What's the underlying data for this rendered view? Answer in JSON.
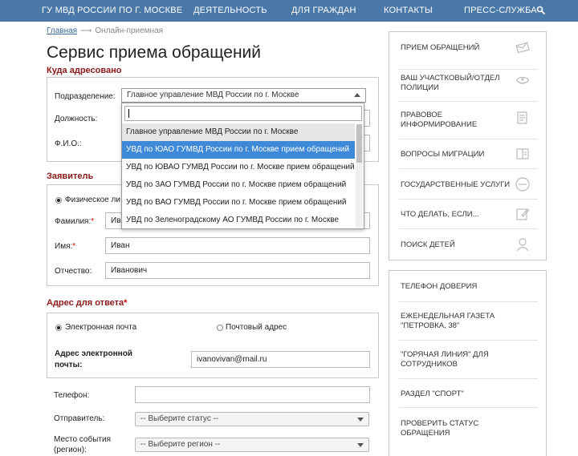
{
  "nav": {
    "items": [
      "ГУ МВД России по г. Москве",
      "Деятельность",
      "Для граждан",
      "Контакты",
      "Пресс-служба"
    ],
    "search_icon": "search-icon",
    "bg_color": "#4a79a9"
  },
  "breadcrumb": {
    "home": "Главная",
    "arrow": "⟶",
    "current": "Онлайн-приемная"
  },
  "page_title": "Сервис приема обращений",
  "to_section": {
    "label": "Куда адресовано",
    "subdivision_label": "Подразделение:",
    "position_label": "Должность:",
    "fio_label": "Ф.И.О.:",
    "subdivision_value": "Главное управление МВД России по г. Москве"
  },
  "dropdown": {
    "search_value": "",
    "options": [
      "Главное управление МВД России по г. Москве",
      "УВД по ЮАО ГУМВД России по г. Москве прием обращений",
      "УВД по ЮВАО ГУМВД России по г. Москве прием обращений",
      "УВД по ЗАО ГУМВД России по г. Москве прием обращений",
      "УВД по ВАО ГУМВД России по г. Москве прием обращений",
      "УВД по Зеленоградскому АО ГУМВД России по г. Москве"
    ],
    "highlight_color": "#3f8ad8"
  },
  "applicant": {
    "label": "Заявитель",
    "physical_label": "Физическое ли",
    "surname_label": "Фамилия:",
    "surname_value": "Ива",
    "name_label": "Имя:",
    "name_value": "Иван",
    "patronymic_label": "Отчество:",
    "patronymic_value": "Иванович",
    "required_mark": "*"
  },
  "reply": {
    "label": "Адрес для ответа",
    "required_mark": "*",
    "email_option": "Электронная почта",
    "post_option": "Почтовый адрес",
    "email_label": "Адрес электронной почты:",
    "email_value": "ivanovivan@mail.ru"
  },
  "other": {
    "phone_label": "Телефон:",
    "phone_value": "",
    "sender_label": "Отправитель:",
    "sender_value": "-- Выберите статус --",
    "region_label": "Место события (регион):",
    "region_value": "-- Выберите регион --"
  },
  "sidebar1": [
    {
      "label": "Прием обращений",
      "icon": "mail-icon"
    },
    {
      "label": "Ваш участковый/отдел полиции",
      "icon": "police-cap-icon"
    },
    {
      "label": "Правовое информирование",
      "icon": "document-icon"
    },
    {
      "label": "Вопросы миграции",
      "icon": "passport-icon"
    },
    {
      "label": "Государственные услуги",
      "icon": "gosuslugi-icon"
    },
    {
      "label": "Что делать, если...",
      "icon": "edit-icon"
    },
    {
      "label": "Поиск детей",
      "icon": "child-icon"
    }
  ],
  "sidebar2": [
    "Телефон доверия",
    "Еженедельная газета \"Петровка, 38\"",
    "\"Горячая линия\" для сотрудников",
    "Раздел \"Спорт\"",
    "Проверить статус обращения"
  ]
}
